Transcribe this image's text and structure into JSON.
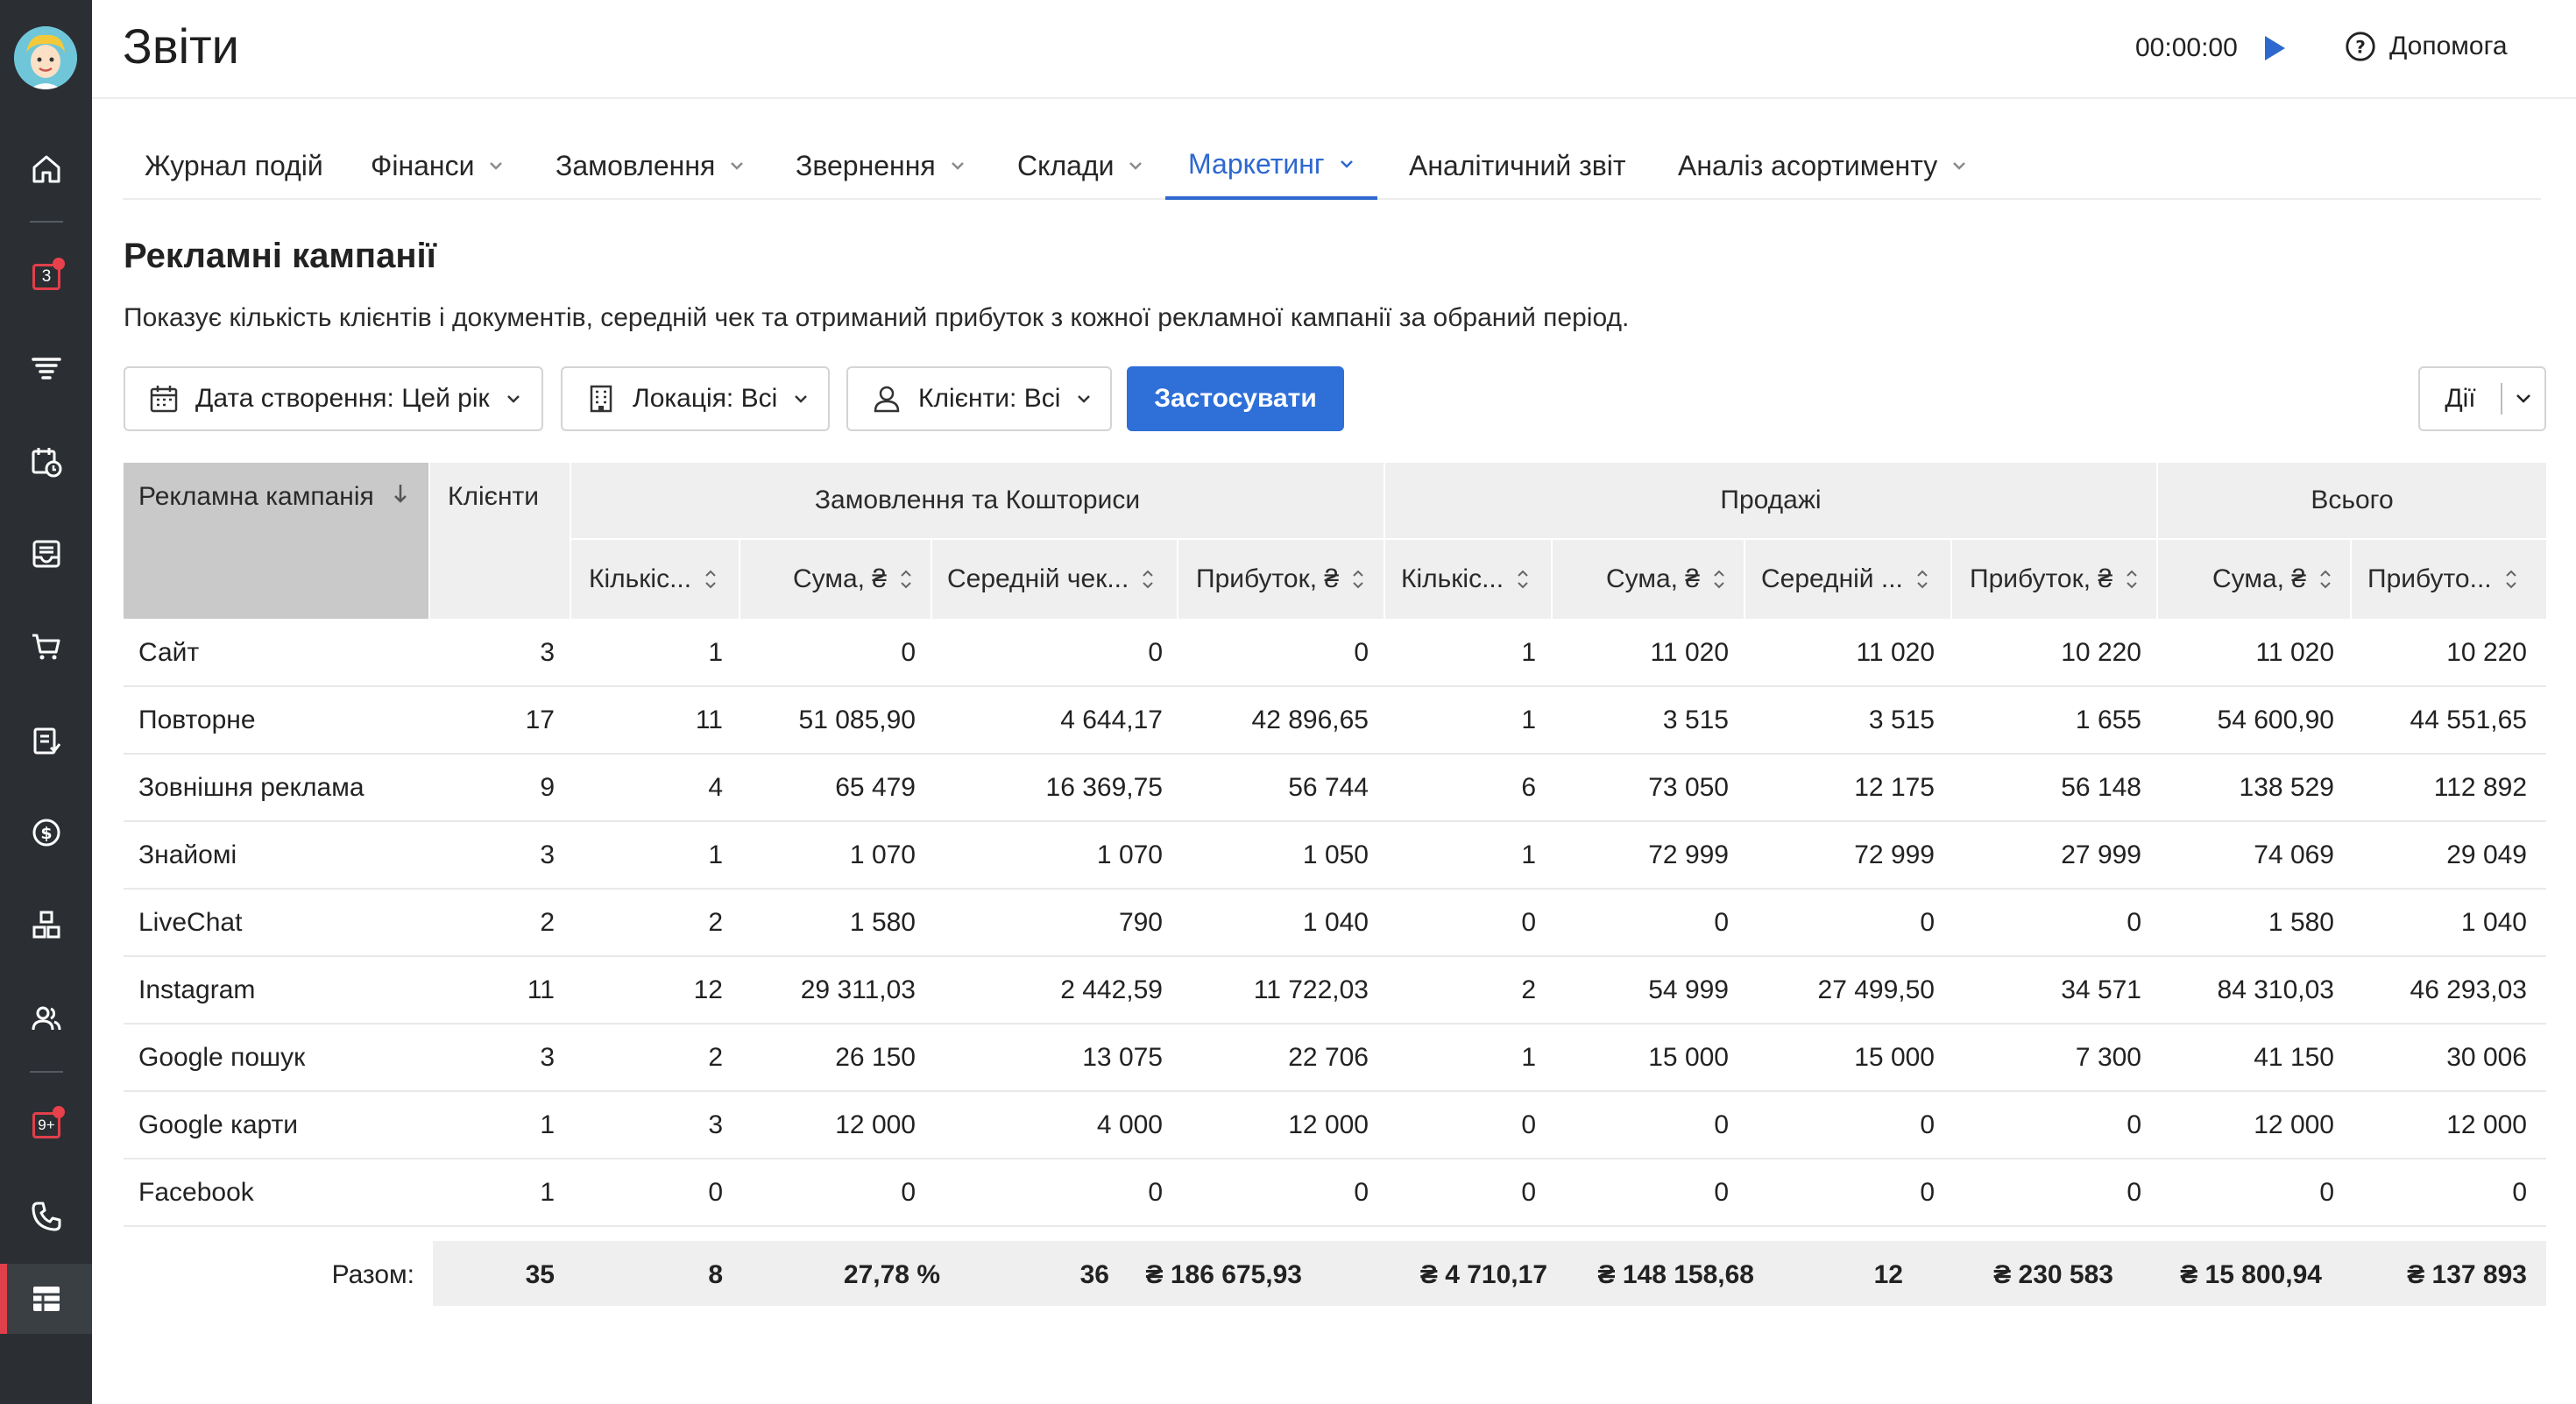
{
  "header": {
    "title": "Звіти",
    "timer": "00:00:00",
    "help_label": "Допомога"
  },
  "sidebar": {
    "badges": {
      "calendar_count": "3",
      "notifications_count": "9+"
    }
  },
  "tabs": [
    {
      "label": "Журнал подій",
      "has_menu": false
    },
    {
      "label": "Фінанси",
      "has_menu": true
    },
    {
      "label": "Замовлення",
      "has_menu": true
    },
    {
      "label": "Звернення",
      "has_menu": true
    },
    {
      "label": "Склади",
      "has_menu": true
    },
    {
      "label": "Маркетинг",
      "has_menu": true,
      "active": true
    },
    {
      "label": "Аналітичний звіт",
      "has_menu": false
    },
    {
      "label": "Аналіз асортименту",
      "has_menu": true
    }
  ],
  "section": {
    "title": "Рекламні кампанії",
    "description": "Показує кількість клієнтів і документів, середній чек та отриманий прибуток з кожної рекламної кампанії за обраний період."
  },
  "filters": {
    "date": "Дата створення: Цей рік",
    "location": "Локація: Всі",
    "clients": "Клієнти: Всі",
    "apply": "Застосувати",
    "actions": "Дії"
  },
  "table": {
    "groups": {
      "campaign": "Рекламна кампанія",
      "clients": "Клієнти",
      "orders": "Замовлення та Кошториси",
      "sales": "Продажі",
      "total": "Всього"
    },
    "columns": [
      "Кількіс...",
      "Сума, ₴",
      "Середній чек...",
      "Прибуток, ₴",
      "Кількіс...",
      "Сума, ₴",
      "Середній ...",
      "Прибуток, ₴",
      "Сума, ₴",
      "Прибуто..."
    ],
    "rows": [
      [
        "Сайт",
        "3",
        "1",
        "0",
        "0",
        "0",
        "1",
        "11 020",
        "11 020",
        "10 220",
        "11 020",
        "10 220"
      ],
      [
        "Повторне",
        "17",
        "11",
        "51 085,90",
        "4 644,17",
        "42 896,65",
        "1",
        "3 515",
        "3 515",
        "1 655",
        "54 600,90",
        "44 551,65"
      ],
      [
        "Зовнішня реклама",
        "9",
        "4",
        "65 479",
        "16 369,75",
        "56 744",
        "6",
        "73 050",
        "12 175",
        "56 148",
        "138 529",
        "112 892"
      ],
      [
        "Знайомі",
        "3",
        "1",
        "1 070",
        "1 070",
        "1 050",
        "1",
        "72 999",
        "72 999",
        "27 999",
        "74 069",
        "29 049"
      ],
      [
        "LiveChat",
        "2",
        "2",
        "1 580",
        "790",
        "1 040",
        "0",
        "0",
        "0",
        "0",
        "1 580",
        "1 040"
      ],
      [
        "Instagram",
        "11",
        "12",
        "29 311,03",
        "2 442,59",
        "11 722,03",
        "2",
        "54 999",
        "27 499,50",
        "34 571",
        "84 310,03",
        "46 293,03"
      ],
      [
        "Google пошук",
        "3",
        "2",
        "26 150",
        "13 075",
        "22 706",
        "1",
        "15 000",
        "15 000",
        "7 300",
        "41 150",
        "30 006"
      ],
      [
        "Google карти",
        "1",
        "3",
        "12 000",
        "4 000",
        "12 000",
        "0",
        "0",
        "0",
        "0",
        "12 000",
        "12 000"
      ],
      [
        "Facebook",
        "1",
        "0",
        "0",
        "0",
        "0",
        "0",
        "0",
        "0",
        "0",
        "0",
        "0"
      ]
    ],
    "totals_label": "Разом:",
    "totals": [
      "35",
      "8",
      "27,78 %",
      "36",
      "₴ 186 675,93",
      "₴ 4 710,17",
      "₴ 148 158,68",
      "12",
      "₴ 230 583",
      "₴ 15 800,94",
      "₴ 137 893"
    ]
  }
}
